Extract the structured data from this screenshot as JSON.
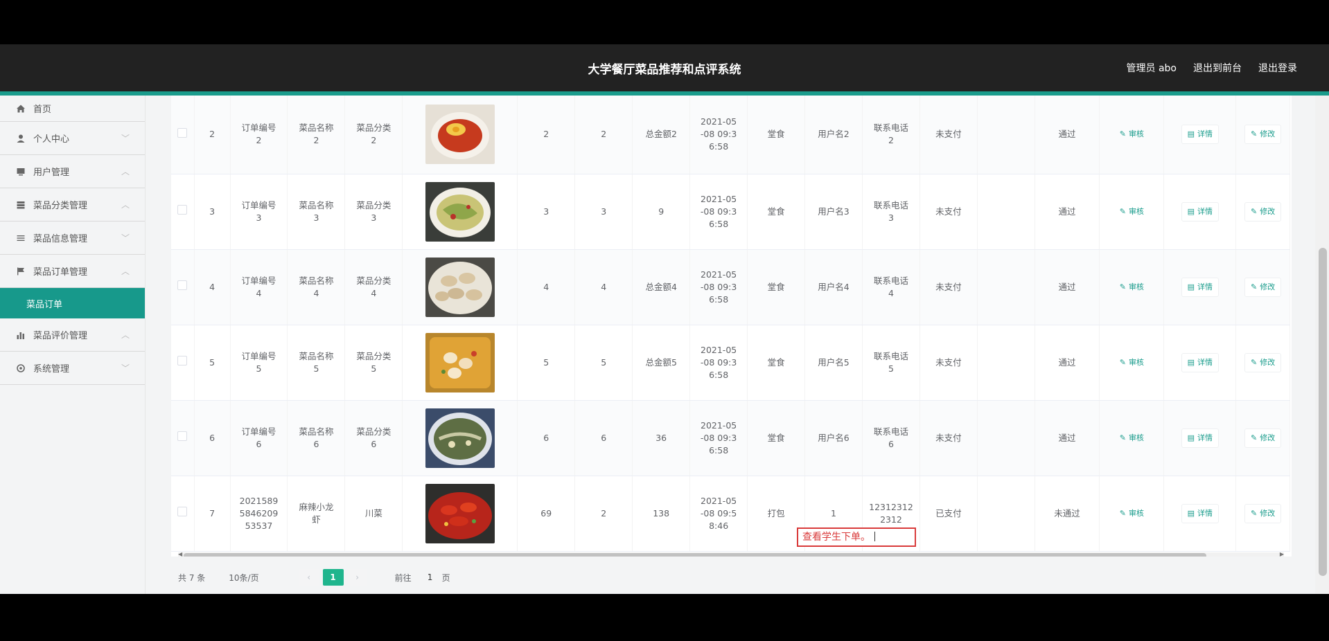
{
  "header": {
    "title": "大学餐厅菜品推荐和点评系统",
    "admin": "管理员 abo",
    "back_front": "退出到前台",
    "logout": "退出登录"
  },
  "sidebar": {
    "items": [
      {
        "label": "首页",
        "icon": "home-icon"
      },
      {
        "label": "个人中心",
        "icon": "person-icon"
      },
      {
        "label": "用户管理",
        "icon": "monitor-icon"
      },
      {
        "label": "菜品分类管理",
        "icon": "grid-icon"
      },
      {
        "label": "菜品信息管理",
        "icon": "list-icon"
      },
      {
        "label": "菜品订单管理",
        "icon": "flag-icon"
      },
      {
        "label": "菜品订单",
        "icon": ""
      },
      {
        "label": "菜品评价管理",
        "icon": "bar-chart-icon"
      },
      {
        "label": "系统管理",
        "icon": "gear-icon"
      }
    ]
  },
  "table": {
    "rows": [
      {
        "idx": "2",
        "order_no": "订单编号\n2",
        "dish_name": "菜品名称\n2",
        "category": "菜品分类\n2",
        "price": "2",
        "qty": "2",
        "total": "总金额2",
        "time": "2021-05\n-08 09:3\n6:58",
        "type": "堂食",
        "user": "用户名2",
        "phone": "联系电话\n2",
        "pay": "未支付",
        "status": "通过",
        "review": "审核",
        "detail": "详情",
        "edit": "修改"
      },
      {
        "idx": "3",
        "order_no": "订单编号\n3",
        "dish_name": "菜品名称\n3",
        "category": "菜品分类\n3",
        "price": "3",
        "qty": "3",
        "total": "9",
        "time": "2021-05\n-08 09:3\n6:58",
        "type": "堂食",
        "user": "用户名3",
        "phone": "联系电话\n3",
        "pay": "未支付",
        "status": "通过",
        "review": "审核",
        "detail": "详情",
        "edit": "修改"
      },
      {
        "idx": "4",
        "order_no": "订单编号\n4",
        "dish_name": "菜品名称\n4",
        "category": "菜品分类\n4",
        "price": "4",
        "qty": "4",
        "total": "总金额4",
        "time": "2021-05\n-08 09:3\n6:58",
        "type": "堂食",
        "user": "用户名4",
        "phone": "联系电话\n4",
        "pay": "未支付",
        "status": "通过",
        "review": "审核",
        "detail": "详情",
        "edit": "修改"
      },
      {
        "idx": "5",
        "order_no": "订单编号\n5",
        "dish_name": "菜品名称\n5",
        "category": "菜品分类\n5",
        "price": "5",
        "qty": "5",
        "total": "总金额5",
        "time": "2021-05\n-08 09:3\n6:58",
        "type": "堂食",
        "user": "用户名5",
        "phone": "联系电话\n5",
        "pay": "未支付",
        "status": "通过",
        "review": "审核",
        "detail": "详情",
        "edit": "修改"
      },
      {
        "idx": "6",
        "order_no": "订单编号\n6",
        "dish_name": "菜品名称\n6",
        "category": "菜品分类\n6",
        "price": "6",
        "qty": "6",
        "total": "36",
        "time": "2021-05\n-08 09:3\n6:58",
        "type": "堂食",
        "user": "用户名6",
        "phone": "联系电话\n6",
        "pay": "未支付",
        "status": "通过",
        "review": "审核",
        "detail": "详情",
        "edit": "修改"
      },
      {
        "idx": "7",
        "order_no": "2021589\n5846209\n53537",
        "dish_name": "麻辣小龙\n虾",
        "category": "川菜",
        "price": "69",
        "qty": "2",
        "total": "138",
        "time": "2021-05\n-08 09:5\n8:46",
        "type": "打包",
        "user": "1",
        "phone": "12312312\n2312",
        "pay": "已支付",
        "status": "未通过",
        "review": "审核",
        "detail": "详情",
        "edit": "修改"
      }
    ]
  },
  "pagination": {
    "total": "共 7 条",
    "page_size": "10条/页",
    "prev": "‹",
    "current": "1",
    "next": "›",
    "goto_label": "前往",
    "goto_value": "1",
    "page_suffix": "页"
  },
  "annotation": {
    "text": "查看学生下单。"
  }
}
